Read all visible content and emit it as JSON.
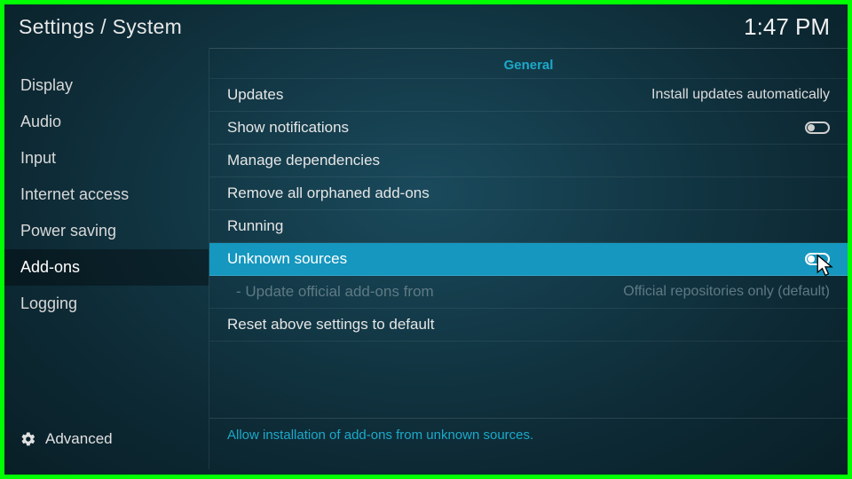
{
  "header": {
    "breadcrumb": "Settings / System",
    "clock": "1:47 PM"
  },
  "sidebar": {
    "items": [
      {
        "label": "Display"
      },
      {
        "label": "Audio"
      },
      {
        "label": "Input"
      },
      {
        "label": "Internet access"
      },
      {
        "label": "Power saving"
      },
      {
        "label": "Add-ons",
        "active": true
      },
      {
        "label": "Logging"
      }
    ],
    "level_label": "Advanced"
  },
  "main": {
    "section": "General",
    "rows": {
      "updates_label": "Updates",
      "updates_value": "Install updates automatically",
      "show_notifications_label": "Show notifications",
      "manage_dependencies_label": "Manage dependencies",
      "remove_orphaned_label": "Remove all orphaned add-ons",
      "running_label": "Running",
      "unknown_sources_label": "Unknown sources",
      "update_official_label": "- Update official add-ons from",
      "update_official_value": "Official repositories only (default)",
      "reset_label": "Reset above settings to default"
    },
    "help": "Allow installation of add-ons from unknown sources."
  }
}
